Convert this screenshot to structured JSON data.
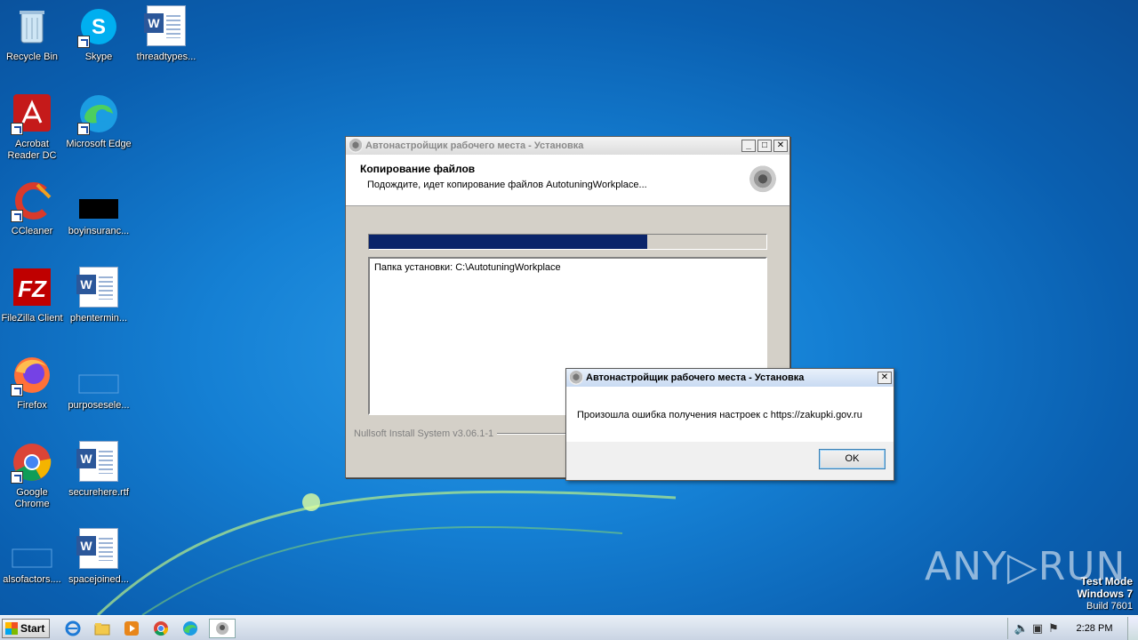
{
  "desktop": {
    "icons": [
      {
        "label": "Recycle Bin"
      },
      {
        "label": "Skype"
      },
      {
        "label": "threadtypes..."
      },
      {
        "label": "Acrobat Reader DC"
      },
      {
        "label": "Microsoft Edge"
      },
      {
        "label": "CCleaner"
      },
      {
        "label": "boyinsuranc..."
      },
      {
        "label": "FileZilla Client"
      },
      {
        "label": "phentermin..."
      },
      {
        "label": "Firefox"
      },
      {
        "label": "purposesele..."
      },
      {
        "label": "Google Chrome"
      },
      {
        "label": "securehere.rtf"
      },
      {
        "label": "alsofactors...."
      },
      {
        "label": "spacejoined..."
      }
    ]
  },
  "installer": {
    "title": "Автонастройщик рабочего места - Установка",
    "header_title": "Копирование файлов",
    "header_subtitle": "Подождите, идет копирование файлов AutotuningWorkplace...",
    "progress": 0.7,
    "log_line": "Папка установки: C:\\AutotuningWorkplace",
    "branding": "Nullsoft Install System v3.06.1-1",
    "btn_min": "_",
    "btn_max": "□",
    "btn_close": "✕"
  },
  "error_dialog": {
    "title": "Автонастройщик рабочего места - Установка",
    "message": "Произошла ошибка получения настроек с https://zakupki.gov.ru",
    "ok_label": "OK",
    "btn_close": "✕"
  },
  "watermark": {
    "brand": "ANY▷RUN",
    "mode_line1": "Test Mode",
    "mode_line2": "Windows 7",
    "mode_line3": "Build 7601"
  },
  "taskbar": {
    "start_label": "Start",
    "clock": "2:28 PM"
  }
}
